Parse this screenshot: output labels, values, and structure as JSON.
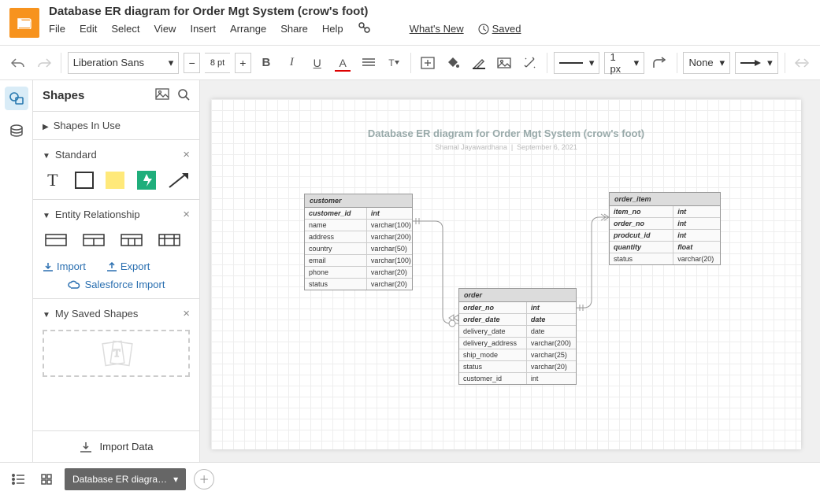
{
  "header": {
    "title": "Database ER diagram for Order  Mgt System (crow's foot)",
    "menus": [
      "File",
      "Edit",
      "Select",
      "View",
      "Insert",
      "Arrange",
      "Share",
      "Help"
    ],
    "whatsnew": "What's New",
    "saved": "Saved"
  },
  "toolbar": {
    "font": "Liberation Sans",
    "fontsize": "8 pt",
    "linewidth": "1 px",
    "fill_none": "None"
  },
  "side": {
    "title": "Shapes",
    "shapes_in_use": "Shapes In Use",
    "standard": "Standard",
    "er": "Entity Relationship",
    "import": "Import",
    "export": "Export",
    "salesforce": "Salesforce Import",
    "my_saved": "My Saved Shapes",
    "import_data": "Import Data"
  },
  "diagram": {
    "title": "Database ER diagram for Order  Mgt System (crow's foot)",
    "author": "Shamal Jayawardhana",
    "date": "September 6, 2021",
    "entities": {
      "customer": {
        "name": "customer",
        "rows": [
          {
            "col": "customer_id",
            "type": "int",
            "pk": true
          },
          {
            "col": "name",
            "type": "varchar(100)"
          },
          {
            "col": "address",
            "type": "varchar(200)"
          },
          {
            "col": "country",
            "type": "varchar(50)"
          },
          {
            "col": "email",
            "type": "varchar(100)"
          },
          {
            "col": "phone",
            "type": "varchar(20)"
          },
          {
            "col": "status",
            "type": "varchar(20)"
          }
        ]
      },
      "order": {
        "name": "order",
        "rows": [
          {
            "col": "order_no",
            "type": "int",
            "pk": true
          },
          {
            "col": "order_date",
            "type": "date",
            "pk": true
          },
          {
            "col": "delivery_date",
            "type": "date"
          },
          {
            "col": "delivery_address",
            "type": "varchar(200)"
          },
          {
            "col": "ship_mode",
            "type": "varchar(25)"
          },
          {
            "col": "status",
            "type": "varchar(20)"
          },
          {
            "col": "customer_id",
            "type": "int"
          }
        ]
      },
      "order_item": {
        "name": "order_item",
        "rows": [
          {
            "col": "item_no",
            "type": "int",
            "pk": true
          },
          {
            "col": "order_no",
            "type": "int",
            "pk": true
          },
          {
            "col": "prodcut_id",
            "type": "int",
            "pk": true
          },
          {
            "col": "quantity",
            "type": "float",
            "pk": true
          },
          {
            "col": "status",
            "type": "varchar(20)"
          }
        ]
      }
    }
  },
  "footer": {
    "tab": "Database ER diagra…"
  }
}
